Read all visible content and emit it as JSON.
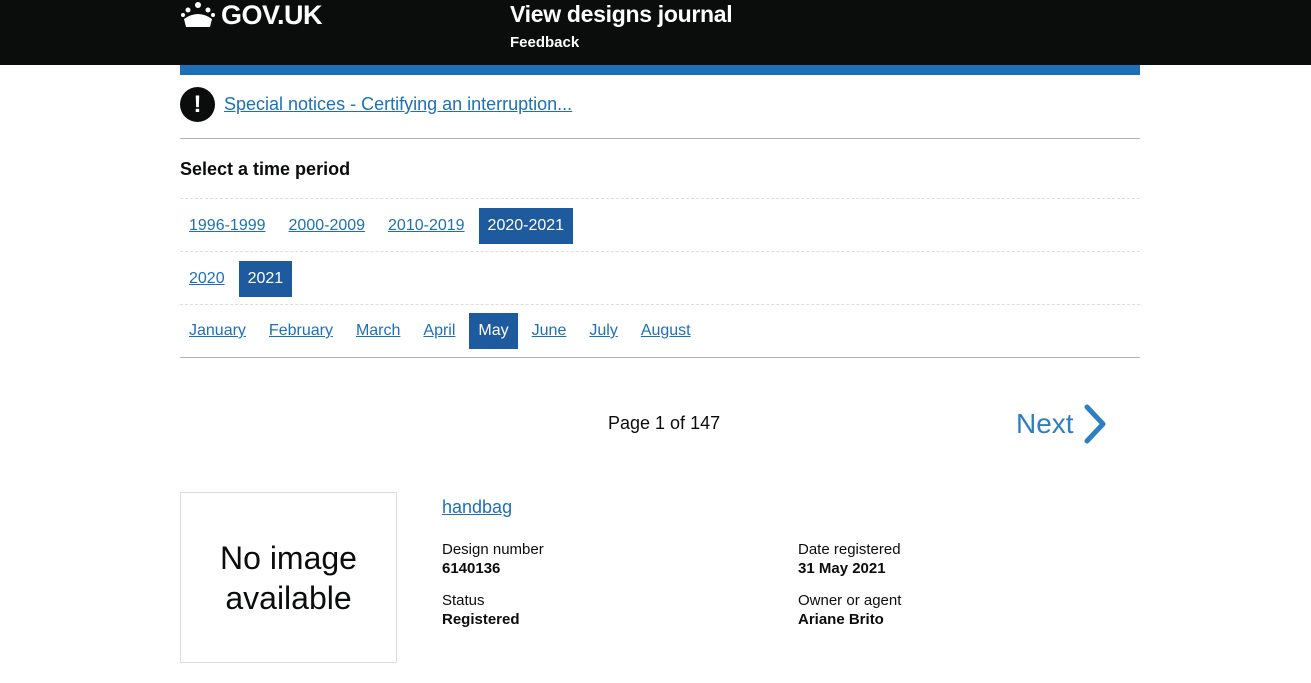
{
  "header": {
    "logo_text": "GOV.UK",
    "service_name": "View designs journal",
    "feedback_label": "Feedback"
  },
  "notice": {
    "icon_glyph": "!",
    "link_text": "Special notices - Certifying an interruption..."
  },
  "time_period": {
    "heading": "Select a time period",
    "decades": [
      "1996-1999",
      "2000-2009",
      "2010-2019",
      "2020-2021"
    ],
    "selected_decade": "2020-2021",
    "years": [
      "2020",
      "2021"
    ],
    "selected_year": "2021",
    "months": [
      "January",
      "February",
      "March",
      "April",
      "May",
      "June",
      "July",
      "August"
    ],
    "selected_month": "May"
  },
  "pagination": {
    "page_info": "Page 1 of 147",
    "next_label": "Next"
  },
  "result": {
    "no_image_text": "No image available",
    "title": "handbag",
    "design_number_label": "Design number",
    "design_number": "6140136",
    "date_registered_label": "Date registered",
    "date_registered": "31 May 2021",
    "status_label": "Status",
    "status": "Registered",
    "owner_label": "Owner or agent",
    "owner": "Ariane Brito"
  },
  "colors": {
    "header_bg": "#0b0c0c",
    "brand_blue": "#1d70b8",
    "selected_bg": "#1d5a9e",
    "link": "#1d70b8"
  }
}
